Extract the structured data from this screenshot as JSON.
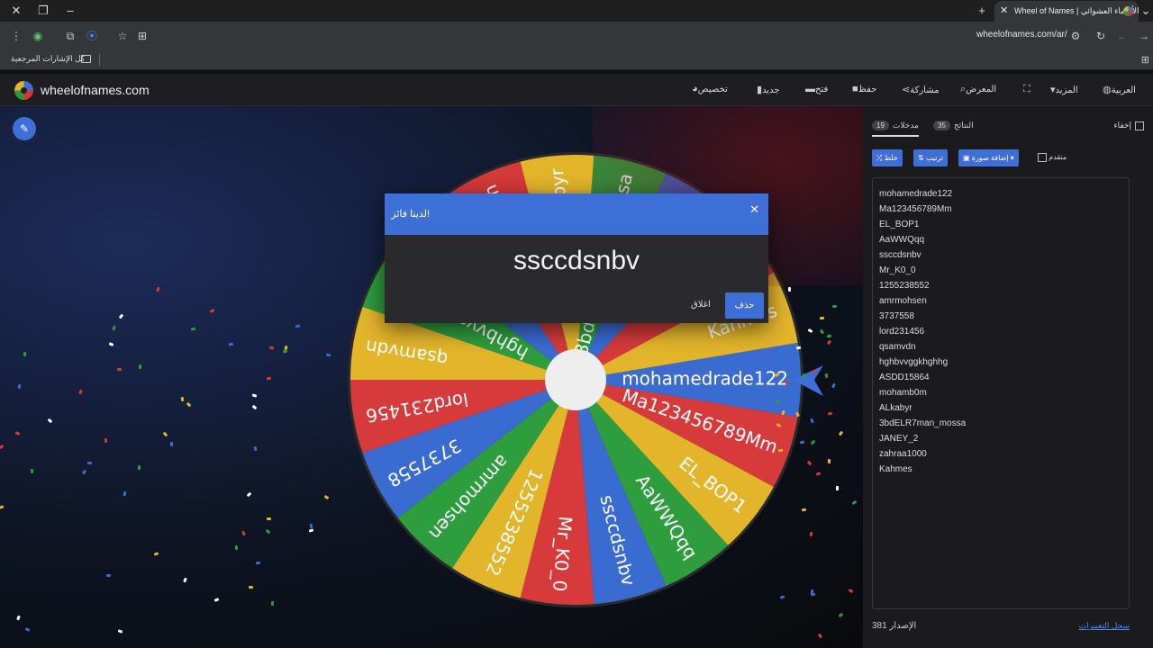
{
  "browser": {
    "tab_title": "Wheel of Names | منتقي الأسماء العشوائي",
    "url": "wheelofnames.com/ar/",
    "bookmarks_label": "كل الإشارات المرجعية"
  },
  "site": {
    "name": "wheelofnames.com",
    "menu": {
      "customize": "تخصيص",
      "new": "جديد",
      "open": "فتح",
      "save": "حفظ",
      "share": "مشاركة",
      "gallery": "المعرض",
      "more": "المزيد",
      "language": "العربية"
    }
  },
  "wheel": {
    "colors": [
      "#3a6bd1",
      "#d63a3a",
      "#e3b52b",
      "#2e9d3e"
    ],
    "labels": [
      "mohamedrade122",
      "Ma123456789Mm",
      "EL_BOP1",
      "AaWWQqq",
      "ssccdsnbv",
      "Mr_K0_0",
      "1255238552",
      "amrmohsen",
      "3737558",
      "lord231456",
      "qsamvdn",
      "hghbvvggkhghhg",
      "ASDD15864",
      "mohamb0m",
      "ALkabyr",
      "3bdELR7man_mossa",
      "JANEY_2",
      "zahraa1000",
      "Kahmes"
    ]
  },
  "dialog": {
    "title": "لدينا فائز!",
    "winner": "ssccdsnbv",
    "remove_label": "حذف",
    "close_label": "اغلاق"
  },
  "panel": {
    "hide_label": "إخفاء",
    "tabs": {
      "entries_label": "مدخلات",
      "entries_count": "19",
      "results_label": "النتائج",
      "results_count": "35"
    },
    "toolbar": {
      "shuffle_label": "خلط",
      "sort_label": "ترتيب",
      "add_image_label": "إضافة صورة",
      "advanced_label": "متقدم"
    },
    "entries": [
      "mohamedrade122",
      "Ma123456789Mm",
      "EL_BOP1",
      "AaWWQqq",
      "ssccdsnbv",
      "Mr_K0_0",
      "1255238552",
      "amrmohsen",
      "3737558",
      "lord231456",
      "qsamvdn",
      "hghbvvggkhghhg",
      "ASDD15864",
      "mohamb0m",
      "ALkabyr",
      "3bdELR7man_mossa",
      "JANEY_2",
      "zahraa1000",
      "Kahmes"
    ],
    "version_label": "الإصدار",
    "version_number": "381",
    "changelog_label": "سجل التغييرات"
  }
}
